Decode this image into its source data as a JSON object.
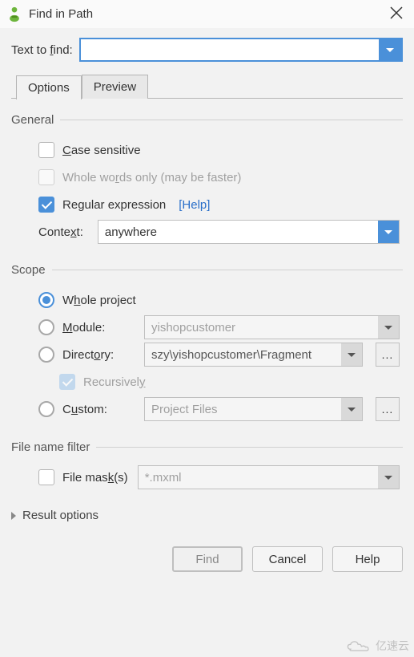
{
  "window": {
    "title": "Find in Path"
  },
  "search": {
    "label_pre": "Text to ",
    "label_key": "f",
    "label_post": "ind:",
    "value": ""
  },
  "tabs": {
    "options": "Options",
    "preview": "Preview"
  },
  "sections": {
    "general": "General",
    "scope": "Scope",
    "filefilter": "File name filter",
    "result": "Result options"
  },
  "general": {
    "case_key": "C",
    "case_rest": "ase sensitive",
    "whole_pre": "Whole wo",
    "whole_key": "r",
    "whole_post": "ds only (may be faster)",
    "regex_pre": "Re",
    "regex_key": "g",
    "regex_post": "ular expression",
    "help": "[Help]",
    "context_label": "Conte",
    "context_key": "x",
    "context_post": "t:",
    "context_value": "anywhere"
  },
  "scope": {
    "whole_pre": "W",
    "whole_key": "h",
    "whole_post": "ole project",
    "module_key": "M",
    "module_rest": "odule:",
    "module_value": "yishopcustomer",
    "dir_pre": "Direct",
    "dir_key": "o",
    "dir_post": "ry:",
    "dir_value": "szy\\yishopcustomer\\Fragment",
    "recursive_pre": "Recursivel",
    "recursive_key": "y",
    "custom_pre": "C",
    "custom_key": "u",
    "custom_post": "stom:",
    "custom_value": "Project Files"
  },
  "filter": {
    "mask_pre": "File mas",
    "mask_key": "k",
    "mask_post": "(s)",
    "mask_value": "*.mxml"
  },
  "buttons": {
    "find": "Find",
    "cancel": "Cancel",
    "help": "Help"
  },
  "ellipsis": "...",
  "watermark": "亿速云"
}
